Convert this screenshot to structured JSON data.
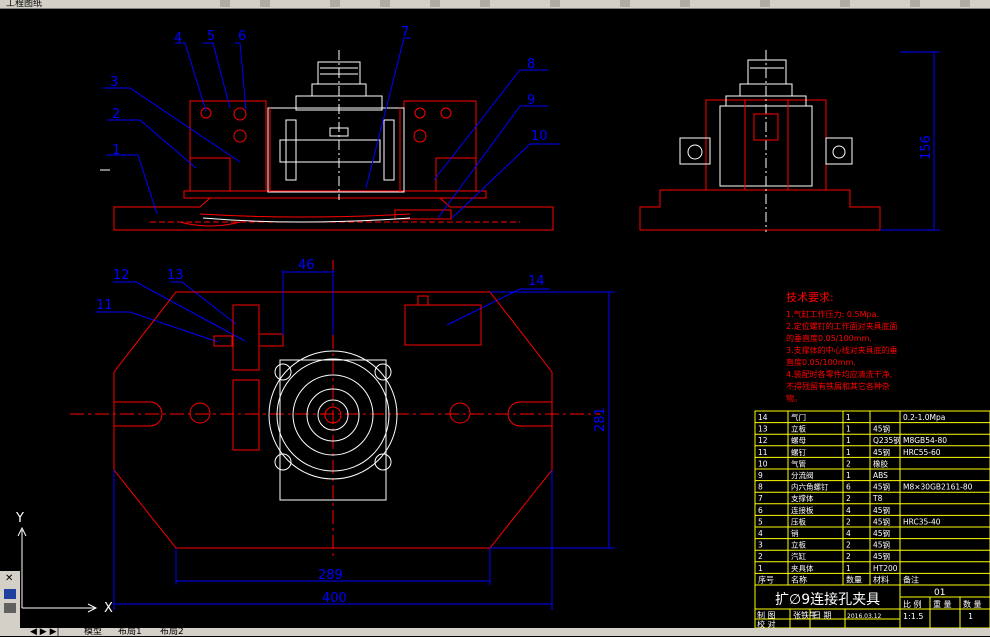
{
  "app": {
    "title": "工程图纸"
  },
  "callouts": [
    "1",
    "2",
    "3",
    "4",
    "5",
    "6",
    "7",
    "8",
    "9",
    "10",
    "11",
    "12",
    "13",
    "14"
  ],
  "dimensions": {
    "d46": "46",
    "d156": "156",
    "d281": "281",
    "d289": "289",
    "d400": "400"
  },
  "tech": {
    "title": "技术要求:",
    "lines": [
      "1.气缸工作压力: 0.5Mpa.",
      "2.定位螺钉的工作面对夹具底面",
      "的垂直度0.05/100mm.",
      "3.支撑体的中心线对夹具底的垂",
      "直度0.05/100mm.",
      "4.装配时各零件均应清洗干净,",
      "不得残留有铁屑和其它各种杂",
      "物。"
    ]
  },
  "bom": {
    "headers": [
      "序号",
      "名称",
      "数量",
      "材料",
      "备注"
    ],
    "rows": [
      [
        "14",
        "气门",
        "1",
        "",
        "0.2-1.0Mpa"
      ],
      [
        "13",
        "立板",
        "1",
        "45钢",
        ""
      ],
      [
        "12",
        "螺母",
        "1",
        "Q235钢",
        "M8GB54-80"
      ],
      [
        "11",
        "螺钉",
        "1",
        "45钢",
        "HRC55-60"
      ],
      [
        "10",
        "气管",
        "2",
        "橡胶",
        ""
      ],
      [
        "9",
        "分流阀",
        "1",
        "ABS",
        ""
      ],
      [
        "8",
        "内六角螺钉",
        "6",
        "45钢",
        "M8×30GB2161-80"
      ],
      [
        "7",
        "支撑体",
        "2",
        "T8",
        ""
      ],
      [
        "6",
        "连接板",
        "4",
        "45钢",
        ""
      ],
      [
        "5",
        "压板",
        "2",
        "45钢",
        "HRC35-40"
      ],
      [
        "4",
        "销",
        "4",
        "45钢",
        ""
      ],
      [
        "3",
        "立板",
        "2",
        "45钢",
        ""
      ],
      [
        "2",
        "汽缸",
        "2",
        "45钢",
        ""
      ],
      [
        "1",
        "夹具体",
        "1",
        "HT200",
        ""
      ]
    ]
  },
  "titleblock": {
    "name": "扩∅9连接孔夹具",
    "code": "01",
    "scale_label": "比 例",
    "scale": "1:1.5",
    "weight_label": "重 量",
    "qty_label": "数 量",
    "qty": "1",
    "draw_label": "制 图",
    "drawer": "张铁牛",
    "date_label": "日 期",
    "date": "2016.03.12",
    "check_label": "校 对"
  },
  "ucs": {
    "x": "X",
    "y": "Y"
  },
  "tabs": [
    "模型",
    "布局1",
    "布局2"
  ],
  "colors": {
    "red": "#ff0000",
    "white": "#ffffff",
    "blue": "#0000ff",
    "yellow": "#ffff00"
  }
}
